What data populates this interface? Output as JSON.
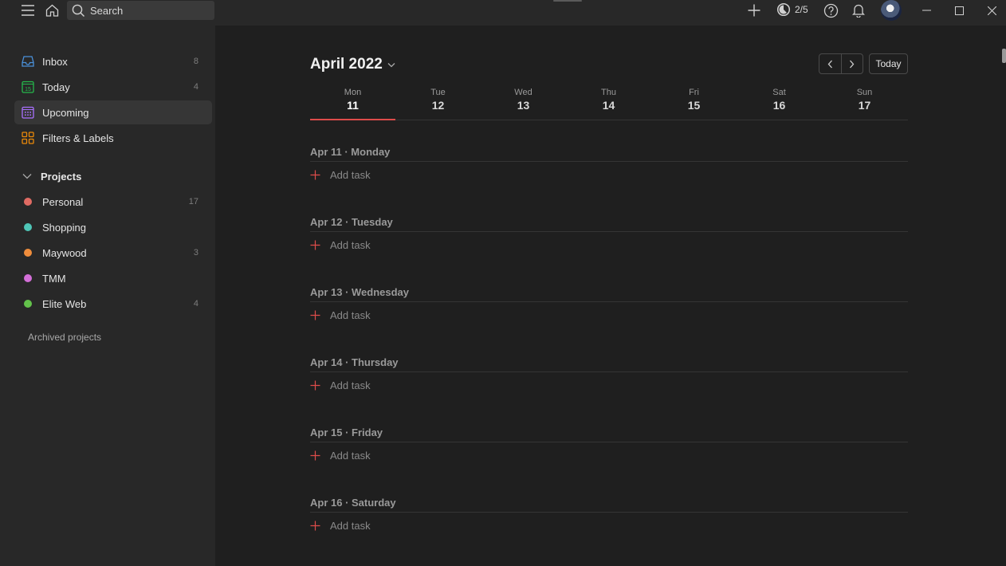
{
  "topbar": {
    "search_placeholder": "Search",
    "karma_label": "2/5",
    "icons": [
      "menu-icon",
      "home-icon",
      "search-icon",
      "plus-icon",
      "productivity-icon",
      "help-icon",
      "bell-icon",
      "avatar",
      "minimize-icon",
      "maximize-icon",
      "close-icon"
    ]
  },
  "sidebar": {
    "items": [
      {
        "label": "Inbox",
        "count": "8",
        "icon": "inbox-icon",
        "color": "#4a90d9"
      },
      {
        "label": "Today",
        "count": "4",
        "icon": "today-icon",
        "color": "#25b84c"
      },
      {
        "label": "Upcoming",
        "count": "",
        "icon": "calendar-icon",
        "color": "#a970ff"
      },
      {
        "label": "Filters & Labels",
        "count": "",
        "icon": "filters-icon",
        "color": "#eb8909"
      }
    ],
    "today_day_number": "15",
    "projects_heading": "Projects",
    "projects": [
      {
        "label": "Personal",
        "count": "17",
        "color": "#e06b63"
      },
      {
        "label": "Shopping",
        "count": "",
        "color": "#4fc6b7"
      },
      {
        "label": "Maywood",
        "count": "3",
        "color": "#ef8d3c"
      },
      {
        "label": "TMM",
        "count": "",
        "color": "#d36fd8"
      },
      {
        "label": "Elite Web",
        "count": "4",
        "color": "#63c24b"
      }
    ],
    "archived_label": "Archived projects"
  },
  "main": {
    "month_label": "April 2022",
    "today_button": "Today",
    "week": [
      {
        "name": "Mon",
        "date": "11"
      },
      {
        "name": "Tue",
        "date": "12"
      },
      {
        "name": "Wed",
        "date": "13"
      },
      {
        "name": "Thu",
        "date": "14"
      },
      {
        "name": "Fri",
        "date": "15"
      },
      {
        "name": "Sat",
        "date": "16"
      },
      {
        "name": "Sun",
        "date": "17"
      }
    ],
    "selected_day": "Mon",
    "sections": [
      {
        "header": "Apr 11 · Monday",
        "add_label": "Add task"
      },
      {
        "header": "Apr 12 · Tuesday",
        "add_label": "Add task"
      },
      {
        "header": "Apr 13 · Wednesday",
        "add_label": "Add task"
      },
      {
        "header": "Apr 14 · Thursday",
        "add_label": "Add task"
      },
      {
        "header": "Apr 15 · Friday",
        "add_label": "Add task"
      },
      {
        "header": "Apr 16 · Saturday",
        "add_label": "Add task"
      }
    ],
    "accent_color": "#de4c4a"
  }
}
